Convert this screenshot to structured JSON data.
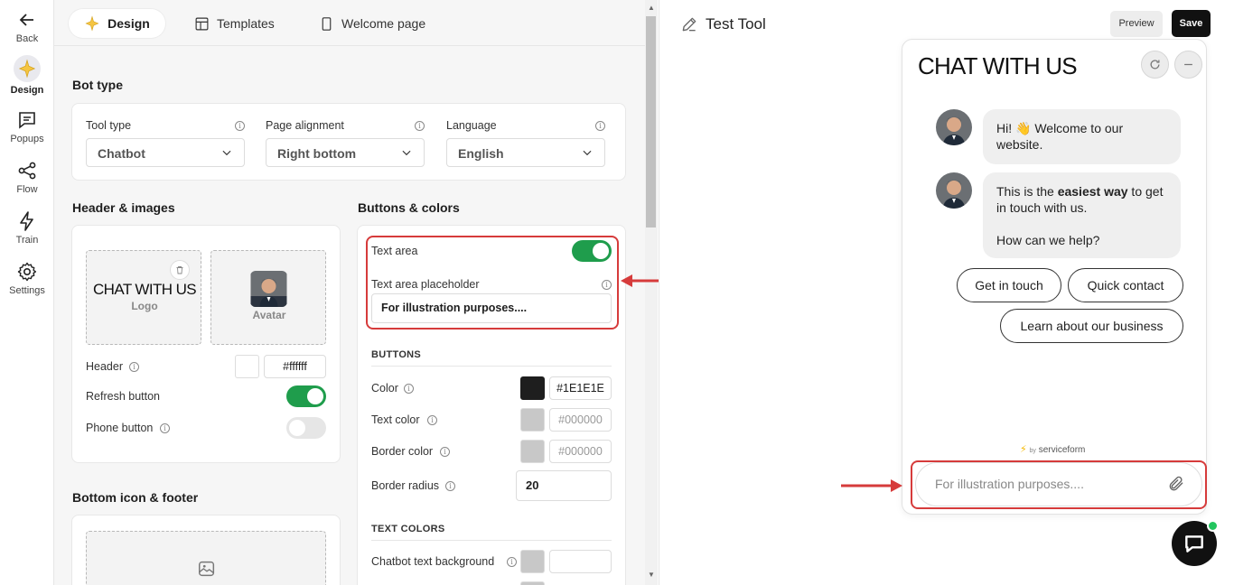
{
  "rail": {
    "back": "Back",
    "design": "Design",
    "popups": "Popups",
    "flow": "Flow",
    "train": "Train",
    "settings": "Settings"
  },
  "tabs": {
    "design": "Design",
    "templates": "Templates",
    "welcome": "Welcome page"
  },
  "bot_type": {
    "title": "Bot type",
    "tool_type_label": "Tool type",
    "tool_type_value": "Chatbot",
    "alignment_label": "Page alignment",
    "alignment_value": "Right bottom",
    "language_label": "Language",
    "language_value": "English"
  },
  "header_images": {
    "title": "Header & images",
    "logo_text": "CHAT WITH US",
    "logo_caption": "Logo",
    "avatar_caption": "Avatar",
    "header_label": "Header",
    "header_color": "#ffffff",
    "refresh_label": "Refresh button",
    "refresh_on": true,
    "phone_label": "Phone button",
    "phone_on": false
  },
  "bottom": {
    "title": "Bottom icon & footer"
  },
  "buttons_colors": {
    "title": "Buttons & colors",
    "text_area_label": "Text area",
    "text_area_on": true,
    "placeholder_label": "Text area placeholder",
    "placeholder_value": "For illustration purposes....",
    "buttons_caps": "BUTTONS",
    "color_label": "Color",
    "color_value": "#1E1E1E",
    "text_color_label": "Text color",
    "text_color_value": "#000000",
    "border_color_label": "Border color",
    "border_color_value": "#000000",
    "border_radius_label": "Border radius",
    "border_radius_value": "20",
    "text_colors_caps": "TEXT COLORS",
    "chatbot_bg_label": "Chatbot text background"
  },
  "preview": {
    "tool_name": "Test Tool",
    "preview_btn": "Preview",
    "save_btn": "Save",
    "widget_title": "CHAT WITH US",
    "msg1": "Hi! 👋 Welcome to our website.",
    "msg2_pre": "This is the ",
    "msg2_bold": "easiest way",
    "msg2_post": " to get in touch with us.",
    "msg2_q": "How can we help?",
    "chip1": "Get in touch",
    "chip2": "Quick contact",
    "chip3": "Learn about our business",
    "brand_by": "by",
    "brand_name": "serviceform",
    "input_placeholder": "For illustration purposes...."
  },
  "colors": {
    "accent_green": "#1f9d4c",
    "highlight_red": "#d63b3b",
    "button_dark": "#1E1E1E"
  }
}
